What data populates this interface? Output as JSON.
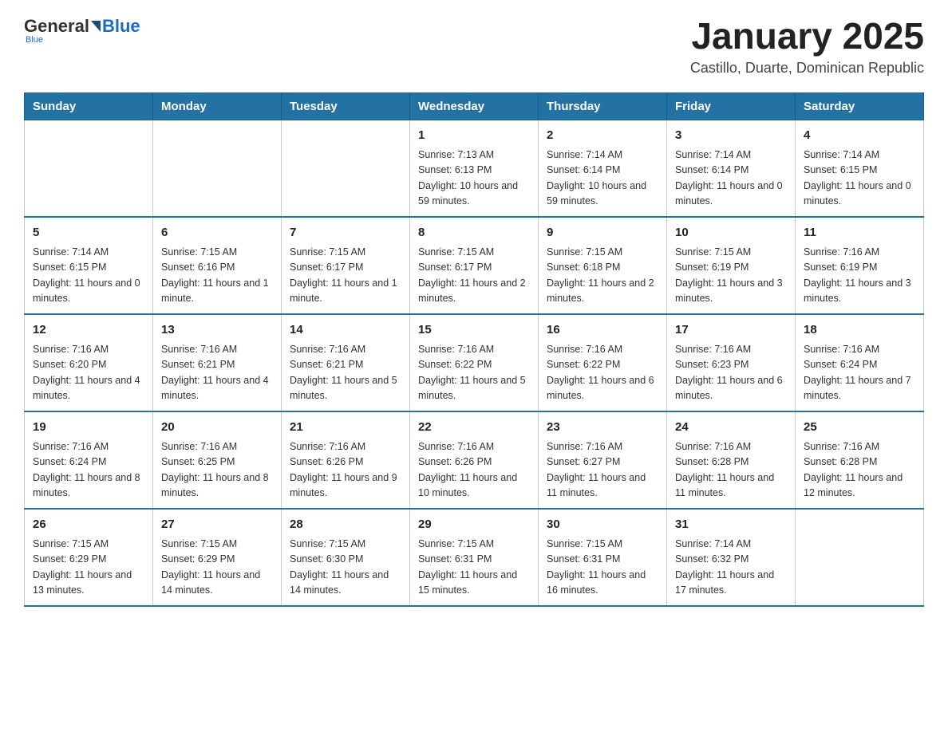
{
  "logo": {
    "general": "General",
    "blue": "Blue",
    "tagline": "Blue"
  },
  "header": {
    "title": "January 2025",
    "subtitle": "Castillo, Duarte, Dominican Republic"
  },
  "days_of_week": [
    "Sunday",
    "Monday",
    "Tuesday",
    "Wednesday",
    "Thursday",
    "Friday",
    "Saturday"
  ],
  "weeks": [
    [
      {
        "day": "",
        "info": ""
      },
      {
        "day": "",
        "info": ""
      },
      {
        "day": "",
        "info": ""
      },
      {
        "day": "1",
        "info": "Sunrise: 7:13 AM\nSunset: 6:13 PM\nDaylight: 10 hours\nand 59 minutes."
      },
      {
        "day": "2",
        "info": "Sunrise: 7:14 AM\nSunset: 6:14 PM\nDaylight: 10 hours\nand 59 minutes."
      },
      {
        "day": "3",
        "info": "Sunrise: 7:14 AM\nSunset: 6:14 PM\nDaylight: 11 hours\nand 0 minutes."
      },
      {
        "day": "4",
        "info": "Sunrise: 7:14 AM\nSunset: 6:15 PM\nDaylight: 11 hours\nand 0 minutes."
      }
    ],
    [
      {
        "day": "5",
        "info": "Sunrise: 7:14 AM\nSunset: 6:15 PM\nDaylight: 11 hours\nand 0 minutes."
      },
      {
        "day": "6",
        "info": "Sunrise: 7:15 AM\nSunset: 6:16 PM\nDaylight: 11 hours\nand 1 minute."
      },
      {
        "day": "7",
        "info": "Sunrise: 7:15 AM\nSunset: 6:17 PM\nDaylight: 11 hours\nand 1 minute."
      },
      {
        "day": "8",
        "info": "Sunrise: 7:15 AM\nSunset: 6:17 PM\nDaylight: 11 hours\nand 2 minutes."
      },
      {
        "day": "9",
        "info": "Sunrise: 7:15 AM\nSunset: 6:18 PM\nDaylight: 11 hours\nand 2 minutes."
      },
      {
        "day": "10",
        "info": "Sunrise: 7:15 AM\nSunset: 6:19 PM\nDaylight: 11 hours\nand 3 minutes."
      },
      {
        "day": "11",
        "info": "Sunrise: 7:16 AM\nSunset: 6:19 PM\nDaylight: 11 hours\nand 3 minutes."
      }
    ],
    [
      {
        "day": "12",
        "info": "Sunrise: 7:16 AM\nSunset: 6:20 PM\nDaylight: 11 hours\nand 4 minutes."
      },
      {
        "day": "13",
        "info": "Sunrise: 7:16 AM\nSunset: 6:21 PM\nDaylight: 11 hours\nand 4 minutes."
      },
      {
        "day": "14",
        "info": "Sunrise: 7:16 AM\nSunset: 6:21 PM\nDaylight: 11 hours\nand 5 minutes."
      },
      {
        "day": "15",
        "info": "Sunrise: 7:16 AM\nSunset: 6:22 PM\nDaylight: 11 hours\nand 5 minutes."
      },
      {
        "day": "16",
        "info": "Sunrise: 7:16 AM\nSunset: 6:22 PM\nDaylight: 11 hours\nand 6 minutes."
      },
      {
        "day": "17",
        "info": "Sunrise: 7:16 AM\nSunset: 6:23 PM\nDaylight: 11 hours\nand 6 minutes."
      },
      {
        "day": "18",
        "info": "Sunrise: 7:16 AM\nSunset: 6:24 PM\nDaylight: 11 hours\nand 7 minutes."
      }
    ],
    [
      {
        "day": "19",
        "info": "Sunrise: 7:16 AM\nSunset: 6:24 PM\nDaylight: 11 hours\nand 8 minutes."
      },
      {
        "day": "20",
        "info": "Sunrise: 7:16 AM\nSunset: 6:25 PM\nDaylight: 11 hours\nand 8 minutes."
      },
      {
        "day": "21",
        "info": "Sunrise: 7:16 AM\nSunset: 6:26 PM\nDaylight: 11 hours\nand 9 minutes."
      },
      {
        "day": "22",
        "info": "Sunrise: 7:16 AM\nSunset: 6:26 PM\nDaylight: 11 hours\nand 10 minutes."
      },
      {
        "day": "23",
        "info": "Sunrise: 7:16 AM\nSunset: 6:27 PM\nDaylight: 11 hours\nand 11 minutes."
      },
      {
        "day": "24",
        "info": "Sunrise: 7:16 AM\nSunset: 6:28 PM\nDaylight: 11 hours\nand 11 minutes."
      },
      {
        "day": "25",
        "info": "Sunrise: 7:16 AM\nSunset: 6:28 PM\nDaylight: 11 hours\nand 12 minutes."
      }
    ],
    [
      {
        "day": "26",
        "info": "Sunrise: 7:15 AM\nSunset: 6:29 PM\nDaylight: 11 hours\nand 13 minutes."
      },
      {
        "day": "27",
        "info": "Sunrise: 7:15 AM\nSunset: 6:29 PM\nDaylight: 11 hours\nand 14 minutes."
      },
      {
        "day": "28",
        "info": "Sunrise: 7:15 AM\nSunset: 6:30 PM\nDaylight: 11 hours\nand 14 minutes."
      },
      {
        "day": "29",
        "info": "Sunrise: 7:15 AM\nSunset: 6:31 PM\nDaylight: 11 hours\nand 15 minutes."
      },
      {
        "day": "30",
        "info": "Sunrise: 7:15 AM\nSunset: 6:31 PM\nDaylight: 11 hours\nand 16 minutes."
      },
      {
        "day": "31",
        "info": "Sunrise: 7:14 AM\nSunset: 6:32 PM\nDaylight: 11 hours\nand 17 minutes."
      },
      {
        "day": "",
        "info": ""
      }
    ]
  ]
}
